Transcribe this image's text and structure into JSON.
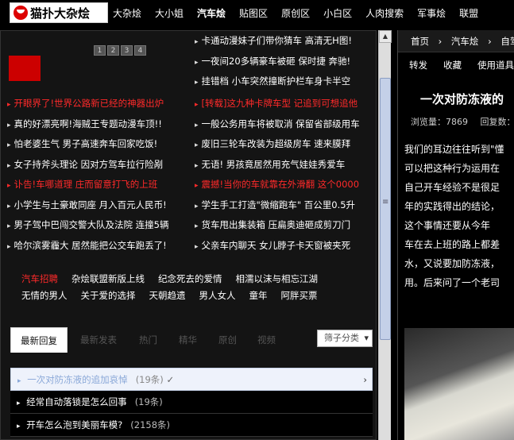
{
  "site": {
    "logo_text": "猫扑大杂烩"
  },
  "nav": {
    "items": [
      "大杂烩",
      "大小姐",
      "汽车烩",
      "贴图区",
      "原创区",
      "小白区",
      "人肉搜索",
      "军事烩",
      "联盟"
    ],
    "active": "汽车烩"
  },
  "pager": [
    "1",
    "2",
    "3",
    "4"
  ],
  "news_right_top": [
    "卡通动漫妹子们带你猜车 高清无H图!",
    "一夜间20多辆豪车被砸 保时捷 奔驰!",
    "挂错档 小车突然撞断护栏车身卡半空"
  ],
  "news_left": [
    {
      "text": "开眼界了!世界公路新已经的神器出炉",
      "red": true
    },
    {
      "text": "真的好漂亮啊!海贼王专题动漫车顶!!",
      "red": false
    },
    {
      "text": "怕老婆生气 男子高速奔车回家吃饭!",
      "red": false
    },
    {
      "text": "女子持斧头理论 因对方驾车拉行险剐",
      "red": false
    },
    {
      "text": "讣告!车哪道理 庄而留意打飞的上班",
      "red": true
    },
    {
      "text": "小学生与土豪敢同座 月入百元人民币!",
      "red": false
    },
    {
      "text": "男子驾中巴闯交警大队及法院 连撞5辆",
      "red": false
    },
    {
      "text": "哈尔滨雾霾大 居然能把公交车跑丢了!",
      "red": false
    }
  ],
  "news_right": [
    {
      "text": "[转载]这九种卡牌车型 记追到可想追他",
      "red": true
    },
    {
      "text": "一般公务用车将被取消 保留省部级用车",
      "red": false
    },
    {
      "text": "废旧三轮车改装为超级房车 速来膜拜",
      "red": false
    },
    {
      "text": "无语! 男孩竟居然用充气娃娃秀爱车",
      "red": false
    },
    {
      "text": "震撼!当你的车就靠在外滑翻 这个0000",
      "red": true
    },
    {
      "text": "学生手工打造\"微缩跑车\" 百公里0.5升",
      "red": false
    },
    {
      "text": "货车甩出集装箱 压扁奥迪砸成剪刀门",
      "red": false
    },
    {
      "text": "父亲车内聊天 女儿脖子卡天窗被夹死",
      "red": false
    }
  ],
  "links": {
    "row1": [
      "汽车招聘",
      "杂烩联盟新版上线",
      "纪念死去的爱情",
      "相濡以沫与相忘江湖"
    ],
    "row2": [
      "无情的男人",
      "关于爱的选择",
      "天朝趋遗",
      "男人女人",
      "童年",
      "阿胖买票"
    ]
  },
  "tabs": {
    "items": [
      "最新回复",
      "最新发表",
      "热门",
      "精华",
      "原创",
      "视频"
    ],
    "dropdown": "筛子分类"
  },
  "replies": [
    {
      "title": "一次对防冻液的追加哀悼",
      "count": "(19条)",
      "selected": true
    },
    {
      "title": "经常自动落锁是怎么回事",
      "count": "(19条)",
      "selected": false
    },
    {
      "title": "开车怎么泡到美丽车模?",
      "count": "(2158条)",
      "selected": false
    }
  ],
  "right": {
    "breadcrumb": [
      "首页",
      "›",
      "汽车烩",
      "›",
      "自驾游"
    ],
    "actions": [
      "转发",
      "收藏",
      "使用道具"
    ],
    "title": "一次对防冻液的",
    "meta_views_label": "浏览量：7869",
    "meta_replies_label": "回复数：",
    "body": [
      "我们的耳边往往听到\"懂",
      "可以把这种行为运用在",
      "  自己开车经验不是很足",
      "年的实践得出的结论，",
      "  这个事情还要从今年",
      "车在去上班的路上都差",
      "水，又说要加防冻液，",
      "用。后来问了一个老司"
    ]
  }
}
